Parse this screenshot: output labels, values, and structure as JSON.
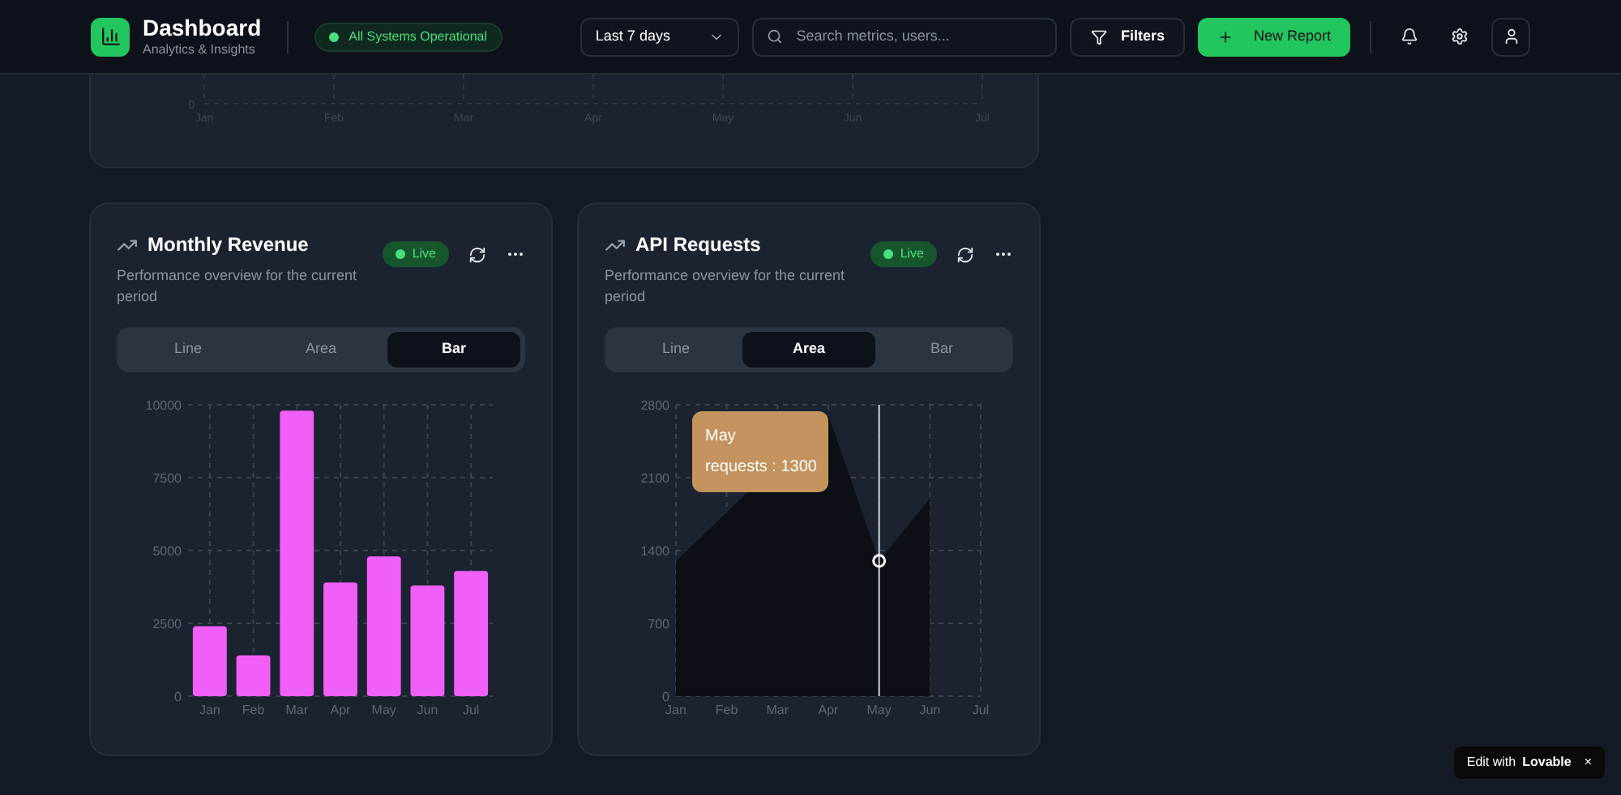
{
  "header": {
    "title": "Dashboard",
    "subtitle": "Analytics & Insights",
    "status": "All Systems Operational",
    "range": "Last 7 days",
    "search": {
      "placeholder": "Search metrics, users..."
    },
    "filters": "Filters",
    "new_report": "New Report"
  },
  "top_card": {
    "y_tick": "0",
    "x_labels": [
      "Jan",
      "Feb",
      "Mar",
      "Apr",
      "May",
      "Jun",
      "Jul"
    ]
  },
  "cards": [
    {
      "title": "Monthly Revenue",
      "description": "Performance overview for the current period",
      "badge": "Live",
      "tabs": [
        {
          "label": "Line",
          "selected": false
        },
        {
          "label": "Area",
          "selected": false
        },
        {
          "label": "Bar",
          "selected": true
        }
      ],
      "chart_data": {
        "type": "bar",
        "categories": [
          "Jan",
          "Feb",
          "Mar",
          "Apr",
          "May",
          "Jun",
          "Jul"
        ],
        "ylim": [
          0,
          10000
        ],
        "yticks": [
          0,
          2500,
          5000,
          7500,
          10000
        ],
        "grid": true,
        "series": [
          {
            "color": "#f05ff7",
            "values": [
              2400,
              1400,
              9800,
              3900,
              4800,
              3800,
              4300
            ]
          }
        ]
      }
    },
    {
      "title": "API Requests",
      "description": "Performance overview for the current period",
      "badge": "Live",
      "tabs": [
        {
          "label": "Line",
          "selected": false
        },
        {
          "label": "Area",
          "selected": true
        },
        {
          "label": "Bar",
          "selected": false
        }
      ],
      "chart_data": {
        "type": "area",
        "categories": [
          "Jan",
          "Feb",
          "Mar",
          "Apr",
          "May",
          "Jun",
          "Jul"
        ],
        "ylim": [
          0,
          2800
        ],
        "yticks": [
          0,
          700,
          1400,
          2100,
          2800
        ],
        "grid": true,
        "series": [
          {
            "color": "#0c1016",
            "values": [
              1300,
              null,
              null,
              2700,
              1300,
              1900,
              null
            ]
          }
        ]
      },
      "tooltip": {
        "title": "May",
        "text": "requests : 1300"
      }
    }
  ],
  "footer_badge": {
    "prefix": "Edit with",
    "brand": "Lovable",
    "close": "×"
  }
}
